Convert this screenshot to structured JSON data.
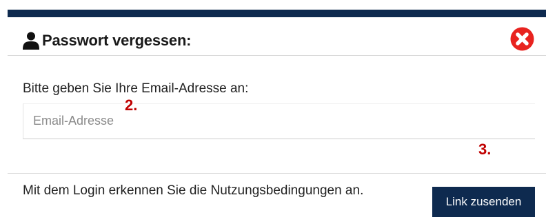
{
  "header": {
    "title": "Passwort vergessen:",
    "user_icon": "user-icon",
    "close_icon": "close-icon",
    "close_color": "#e8231f"
  },
  "body": {
    "label": "Bitte geben Sie Ihre Email-Adresse an:",
    "email": {
      "value": "",
      "placeholder": "Email-Adresse"
    }
  },
  "footer": {
    "terms_text": "Mit dem Login erkennen Sie die Nutzungsbedingungen an.",
    "send_label": "Link zusenden"
  },
  "annotations": {
    "marker_2": "2.",
    "marker_3": "3."
  },
  "colors": {
    "brand": "#0e2a4f",
    "marker": "#c00000"
  }
}
